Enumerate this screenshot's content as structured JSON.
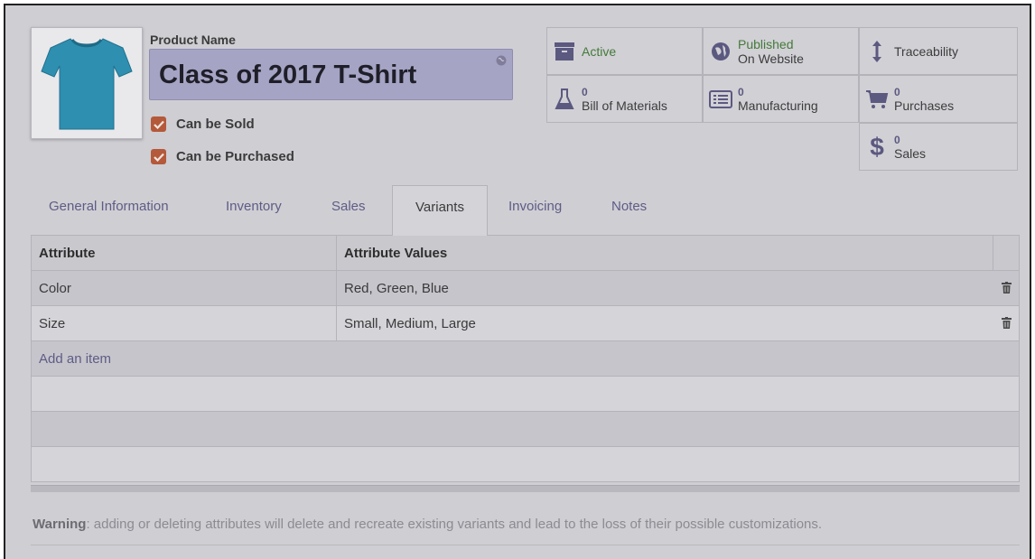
{
  "product": {
    "name_label": "Product Name",
    "name": "Class of 2017 T-Shirt",
    "can_be_sold_label": "Can be Sold",
    "can_be_sold": true,
    "can_be_purchased_label": "Can be Purchased",
    "can_be_purchased": true,
    "image_icon": "tshirt-image"
  },
  "smart_buttons": {
    "active": {
      "label": "Active",
      "icon": "archive-icon"
    },
    "published": {
      "line1": "Published",
      "line2": "On Website",
      "icon": "globe-icon"
    },
    "traceability": {
      "label": "Traceability",
      "icon": "vertical-arrows-icon"
    },
    "bom": {
      "count": "0",
      "label": "Bill of Materials",
      "icon": "flask-icon"
    },
    "manufacturing": {
      "count": "0",
      "label": "Manufacturing",
      "icon": "list-icon"
    },
    "purchases": {
      "count": "0",
      "label": "Purchases",
      "icon": "cart-icon"
    },
    "sales": {
      "count": "0",
      "label": "Sales",
      "icon": "dollar-icon"
    }
  },
  "tabs": [
    {
      "label": "General Information"
    },
    {
      "label": "Inventory"
    },
    {
      "label": "Sales"
    },
    {
      "label": "Variants",
      "active": true
    },
    {
      "label": "Invoicing"
    },
    {
      "label": "Notes"
    }
  ],
  "table": {
    "headers": [
      "Attribute",
      "Attribute Values"
    ],
    "rows": [
      {
        "attribute": "Color",
        "values": "Red, Green, Blue"
      },
      {
        "attribute": "Size",
        "values": "Small, Medium, Large"
      }
    ],
    "add_item": "Add an item"
  },
  "warning": {
    "label": "Warning",
    "text": ": adding or deleting attributes will delete and recreate existing variants and lead to the loss of their possible customizations."
  },
  "colors": {
    "checkbox": "#b4593a",
    "name_field": "#a6a4c4",
    "link": "#5e5c86",
    "published_green": "#447a3a",
    "tshirt": "#2e8fb0"
  }
}
